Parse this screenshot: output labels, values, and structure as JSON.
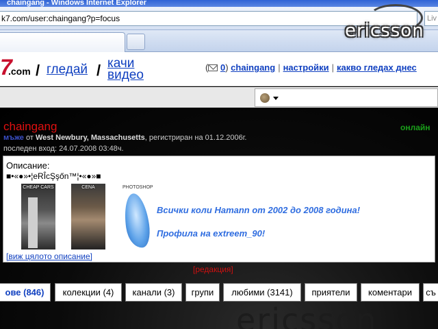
{
  "browser": {
    "title": "chaingang - Windows Internet Explorer",
    "url": "k7.com/user:chaingang?p=focus",
    "search_placeholder": "Liv"
  },
  "site": {
    "logo_fragment": "7",
    "logo_suffix": ".com",
    "nav": [
      {
        "label": "гледай"
      },
      {
        "label": "качи\nвидео"
      }
    ],
    "user_links": {
      "mail_open": "(",
      "mail_count": "0",
      "mail_close": ")",
      "username": "chaingang",
      "settings": "настройки",
      "watching": "какво гледах днес"
    }
  },
  "profile": {
    "username": "chaingang",
    "status": "онлайн",
    "gender_label": "мъже",
    "location_prefix": "от",
    "location": "West Newbury, Massachusetts",
    "registered": ", регистриран на 01.12.2006г.",
    "last_login": "последен вход: 24.07.2008 03:48ч.",
    "description": {
      "label": "Описание:",
      "decoration": "■•«●»•¦eRÎcŞşőn™¦•«●»■",
      "thumbnails": [
        {
          "caption": "CHEAP CARS",
          "icon": "car-thumbnail"
        },
        {
          "caption": "CENA",
          "icon": "wrestler-thumbnail"
        },
        {
          "caption": "PHOTOSHOP",
          "icon": "photoshop-thumbnail"
        }
      ],
      "promo_line_1": "Всички коли Hamann от 2002 до 2008 година!",
      "promo_line_2": "Профила на extreem_90!",
      "full_link": "[виж цялото описание]"
    },
    "edit_link": "[редакция]",
    "tabs": [
      {
        "label": "ове (846)",
        "active": true
      },
      {
        "label": "колекции (4)",
        "active": false
      },
      {
        "label": "канали (3)",
        "active": false
      },
      {
        "label": "групи",
        "active": false
      },
      {
        "label": "любими (3141)",
        "active": false
      },
      {
        "label": "приятели",
        "active": false
      },
      {
        "label": "коментари",
        "active": false
      },
      {
        "label": "съ",
        "active": false
      }
    ]
  },
  "watermark": {
    "text": "ericsson",
    "bottom_text": "ericsson"
  },
  "colors": {
    "link": "#1040c0",
    "username": "#e01010",
    "online": "#1aa01a",
    "promo": "#2f6de0"
  }
}
